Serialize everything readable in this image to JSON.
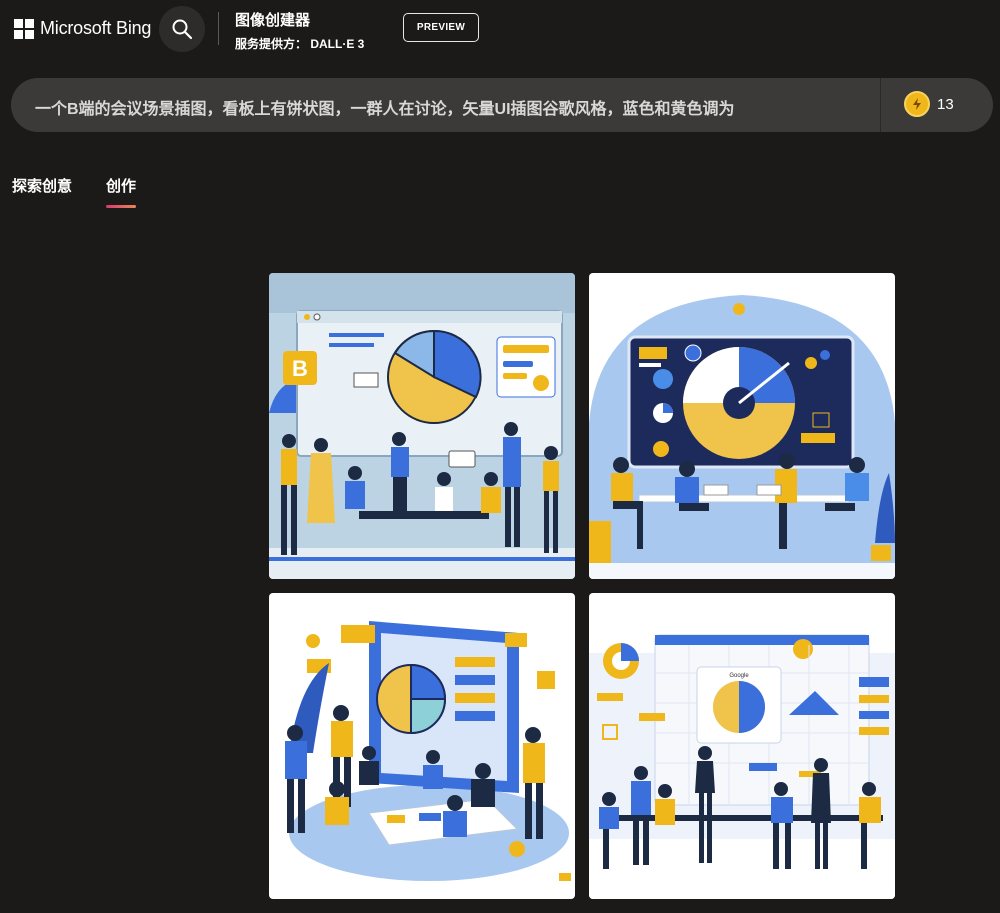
{
  "header": {
    "brand": "Microsoft Bing",
    "title": "图像创建器",
    "subtitle": "服务提供方： DALL·E 3",
    "preview_label": "PREVIEW"
  },
  "prompt": {
    "text": "一个B端的会议场景插图，看板上有饼状图，一群人在讨论，矢量UI插图谷歌风格，蓝色和黄色调为",
    "boosts": "13"
  },
  "tabs": [
    {
      "label": "探索创意",
      "active": false
    },
    {
      "label": "创作",
      "active": true
    }
  ],
  "images": {
    "img1_board_letter": "B",
    "img4_chart_title": "Google"
  },
  "colors": {
    "accent_yellow": "#f0b71a",
    "accent_blue": "#3b6fdc",
    "tab_underline_start": "#d83b6f",
    "tab_underline_end": "#e8875a"
  }
}
